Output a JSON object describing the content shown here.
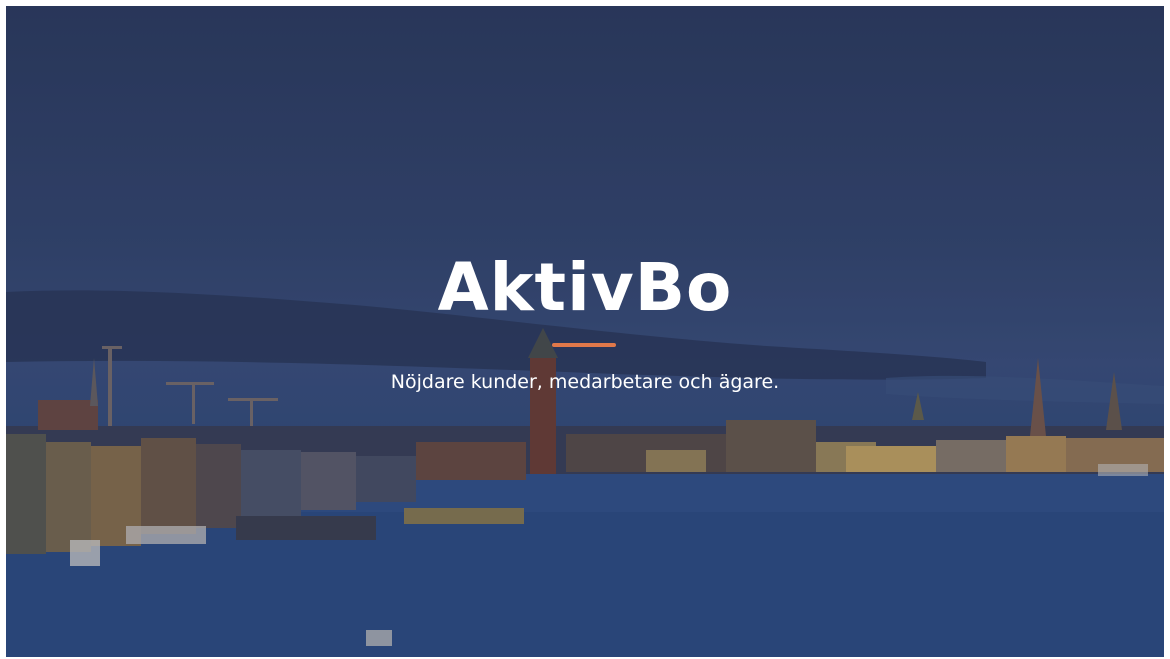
{
  "hero": {
    "title": "AktivBo",
    "tagline": "Nöjdare kunder, medarbetare och ägare.",
    "background_image": "stockholm-waterfront-dusk-photo"
  },
  "colors": {
    "accent": "#e0784a",
    "text": "#ffffff",
    "sky": "#34466d",
    "water": "#2a4a7e"
  }
}
